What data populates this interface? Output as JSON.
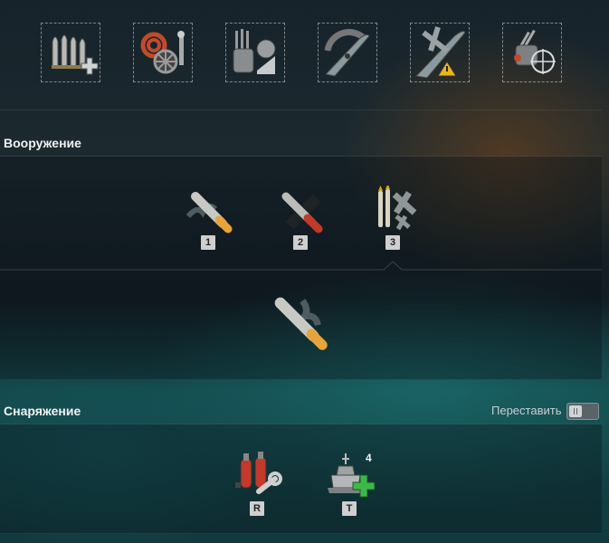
{
  "top_modules": [
    {
      "name": "main-battery-ammo-upgrade"
    },
    {
      "name": "damage-control-upgrade"
    },
    {
      "name": "secondary-battery-upgrade"
    },
    {
      "name": "steering-gear-upgrade"
    },
    {
      "name": "aircraft-upgrade"
    },
    {
      "name": "aa-targeting-upgrade"
    }
  ],
  "armament": {
    "title": "Вооружение",
    "items": [
      {
        "key": "1",
        "name": "he-shell"
      },
      {
        "key": "2",
        "name": "ap-shell"
      },
      {
        "key": "3",
        "name": "aa-and-fighters"
      }
    ],
    "selected_item": "he-shell-large"
  },
  "consumables": {
    "title": "Снаряжение",
    "rearrange_label": "Переставить",
    "items": [
      {
        "key": "R",
        "name": "damage-control-party"
      },
      {
        "key": "T",
        "name": "repair-party",
        "count": "4"
      }
    ]
  }
}
